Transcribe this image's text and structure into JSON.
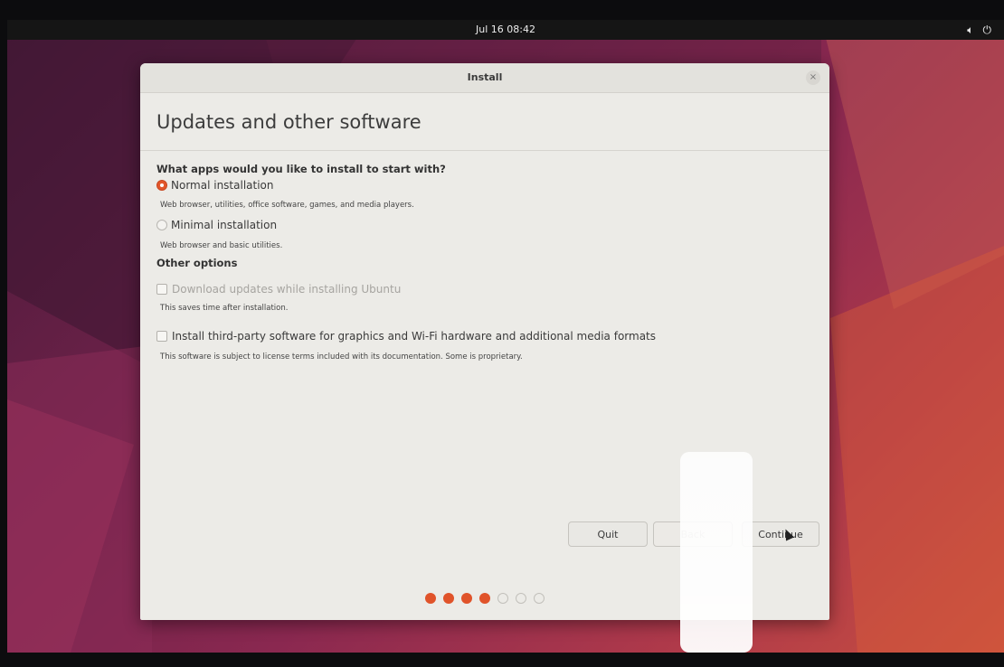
{
  "topbar": {
    "clock": "Jul 16 08:42",
    "tray_icons": [
      "speaker-icon",
      "power-icon"
    ]
  },
  "window": {
    "title": "Install",
    "close_glyph": "×"
  },
  "page": {
    "title": "Updates and other software"
  },
  "question": "What apps would you like to install to start with?",
  "options": {
    "normal": {
      "label": "Normal installation",
      "desc": "Web browser, utilities, office software, games, and media players.",
      "selected": true
    },
    "minimal": {
      "label": "Minimal installation",
      "desc": "Web browser and basic utilities.",
      "selected": false
    }
  },
  "other_options_label": "Other options",
  "checkboxes": {
    "updates": {
      "label": "Download updates while installing Ubuntu",
      "desc": "This saves time after installation.",
      "checked": false,
      "disabled": true
    },
    "third_party": {
      "label": "Install third-party software for graphics and Wi-Fi hardware and additional media formats",
      "desc": "This software is subject to license terms included with its documentation. Some is proprietary.",
      "checked": false,
      "disabled": false
    }
  },
  "buttons": {
    "quit": "Quit",
    "back": "Back",
    "continue": "Continue"
  },
  "progress": {
    "total_steps": 7,
    "completed_steps": 4
  },
  "colors": {
    "accent": "#e0532a",
    "window_bg": "#ecebe7",
    "topbar_bg": "#151515"
  }
}
